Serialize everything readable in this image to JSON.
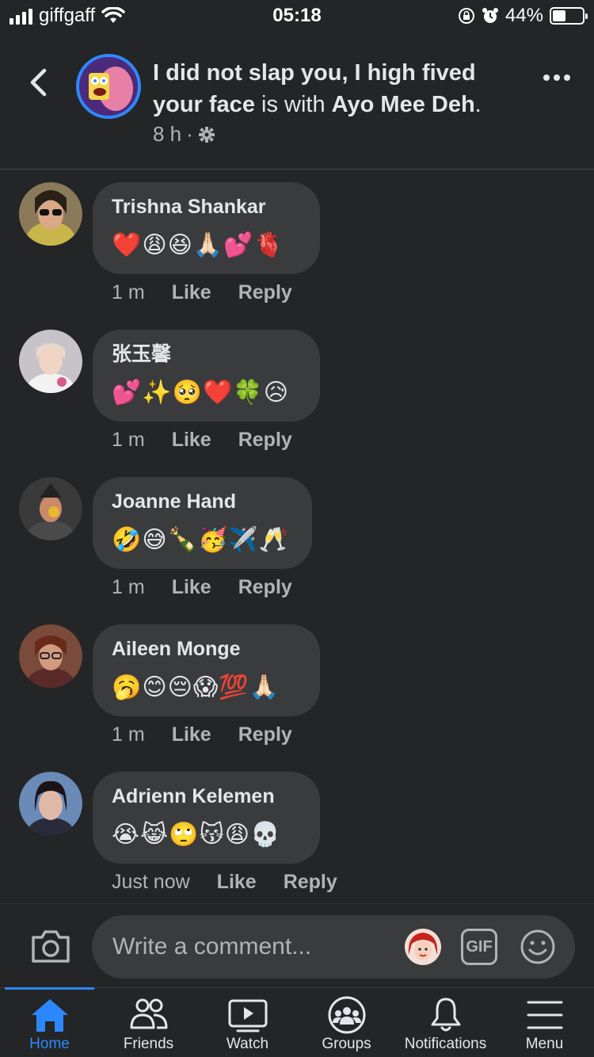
{
  "status_bar": {
    "carrier": "giffgaff",
    "time": "05:18",
    "battery": "44%",
    "battery_level": 0.44
  },
  "header": {
    "title_part1": "I did not slap you, I high fived your face",
    "title_connector": " is with ",
    "tagged": "Ayo Mee Deh",
    "title_end": ".",
    "time": "8 h",
    "dot": "·"
  },
  "comments": [
    {
      "name": "Trishna Shankar",
      "text": "❤️😩😆🙏🏻💕🫀",
      "time": "1 m",
      "like": "Like",
      "reply": "Reply"
    },
    {
      "name": "张玉馨",
      "text": "💕✨🥺❤️🍀😥",
      "time": "1 m",
      "like": "Like",
      "reply": "Reply"
    },
    {
      "name": "Joanne Hand",
      "text": "🤣😅🍾🥳✈️🥂",
      "time": "1 m",
      "like": "Like",
      "reply": "Reply"
    },
    {
      "name": "Aileen Monge",
      "text": "🥱😊😔😱💯🙏🏻",
      "time": "1 m",
      "like": "Like",
      "reply": "Reply"
    },
    {
      "name": "Adrienn Kelemen",
      "text": "😭😹🙄😽😩💀",
      "time": "Just now",
      "like": "Like",
      "reply": "Reply"
    }
  ],
  "composer": {
    "placeholder": "Write a comment...",
    "gif_label": "GIF"
  },
  "tabs": [
    {
      "label": "Home",
      "icon": "home-icon",
      "active": true
    },
    {
      "label": "Friends",
      "icon": "friends-icon",
      "active": false
    },
    {
      "label": "Watch",
      "icon": "watch-icon",
      "active": false
    },
    {
      "label": "Groups",
      "icon": "groups-icon",
      "active": false
    },
    {
      "label": "Notifications",
      "icon": "bell-icon",
      "active": false
    },
    {
      "label": "Menu",
      "icon": "menu-icon",
      "active": false
    }
  ],
  "colors": {
    "background": "#242526",
    "bubble": "#3a3b3c",
    "accent": "#2d88ff",
    "secondary_text": "#b0b3b8"
  }
}
